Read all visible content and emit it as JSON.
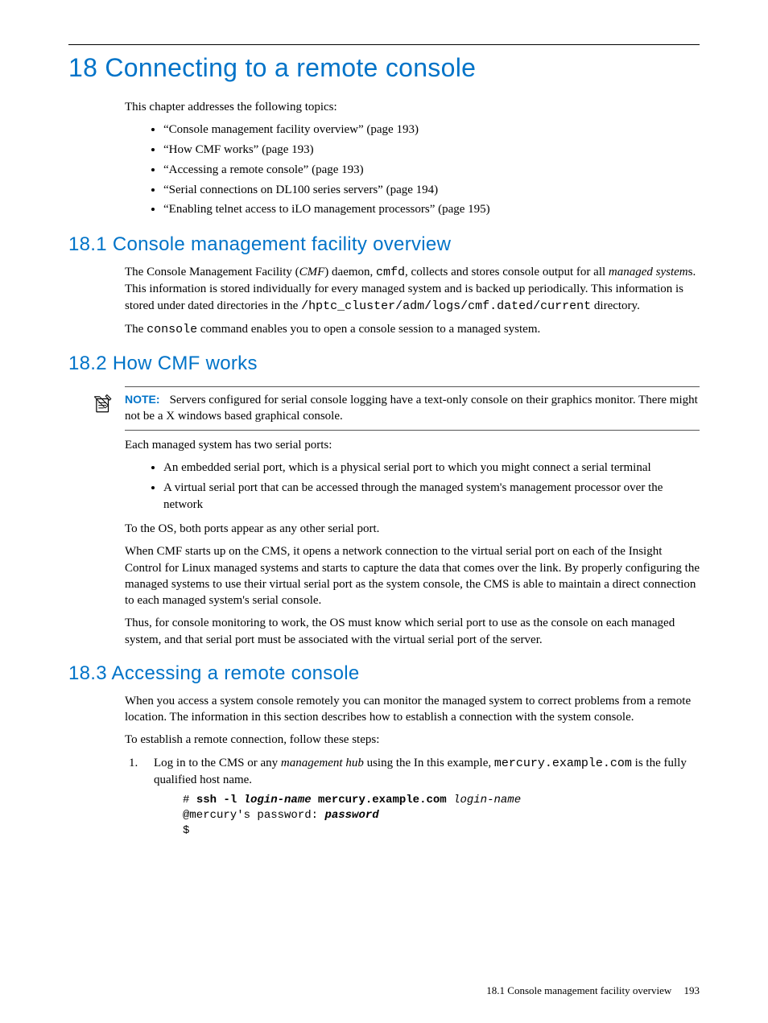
{
  "chapter_title": "18 Connecting to a remote console",
  "intro": "This chapter addresses the following topics:",
  "toc": [
    "“Console management facility overview” (page 193)",
    "“How CMF works” (page 193)",
    "“Accessing a remote console” (page 193)",
    "“Serial connections on DL100 series servers” (page 194)",
    "“Enabling telnet access to iLO management processors” (page 195)"
  ],
  "s1": {
    "heading": "18.1 Console management facility overview",
    "p1a": "The Console Management Facility (",
    "p1b": "CMF",
    "p1c": ") daemon, ",
    "p1d": "cmfd",
    "p1e": ", collects and stores console output for all ",
    "p1f": "managed system",
    "p1g": "s. This information is stored individually for every managed system and is backed up periodically. This information is stored under dated directories in the ",
    "p1h": "/hptc_cluster/adm/logs/cmf.dated/current",
    "p1i": " directory.",
    "p2a": "The ",
    "p2b": "console",
    "p2c": " command enables you to open a console session to a managed system."
  },
  "s2": {
    "heading": "18.2 How CMF works",
    "note_label": "NOTE:",
    "note_text": "Servers configured for serial console logging have a text-only console on their graphics monitor. There might not be a X windows based graphical console.",
    "p1": "Each managed system has two serial ports:",
    "bullets": [
      "An embedded serial port, which is a physical serial port to which you might connect a serial terminal",
      "A virtual serial port that can be accessed through the managed system's management processor over the network"
    ],
    "p2": "To the OS, both ports appear as any other serial port.",
    "p3": "When CMF starts up on the CMS, it opens a network connection to the virtual serial port on each of the Insight Control for Linux managed systems and starts to capture the data that comes over the link. By properly configuring the managed systems to use their virtual serial port as the system console, the CMS is able to maintain a direct connection to each managed system's serial console.",
    "p4": "Thus, for console monitoring to work, the OS must know which serial port to use as the console on each managed system, and that serial port must be associated with the virtual serial port of the server."
  },
  "s3": {
    "heading": "18.3 Accessing a remote console",
    "p1": "When you access a system console remotely you can monitor the managed system to correct problems from a remote location. The information in this section describes how to establish a connection with the system console.",
    "p2": "To establish a remote connection, follow these steps:",
    "step1a": "Log in to the CMS or any ",
    "step1b": "management hub",
    "step1c": " using the In this example, ",
    "step1d": "mercury.example.com",
    "step1e": " is the fully qualified host name.",
    "code1_l1a": "# ",
    "code1_l1b": "ssh -l ",
    "code1_l1c": "login-name",
    "code1_l1d": " mercury.example.com ",
    "code1_l1e": "login-name",
    "code1_l2a": "@mercury's password: ",
    "code1_l2b": "password",
    "code1_l3": "$"
  },
  "footer": {
    "label": "18.1 Console management facility overview",
    "page": "193"
  }
}
